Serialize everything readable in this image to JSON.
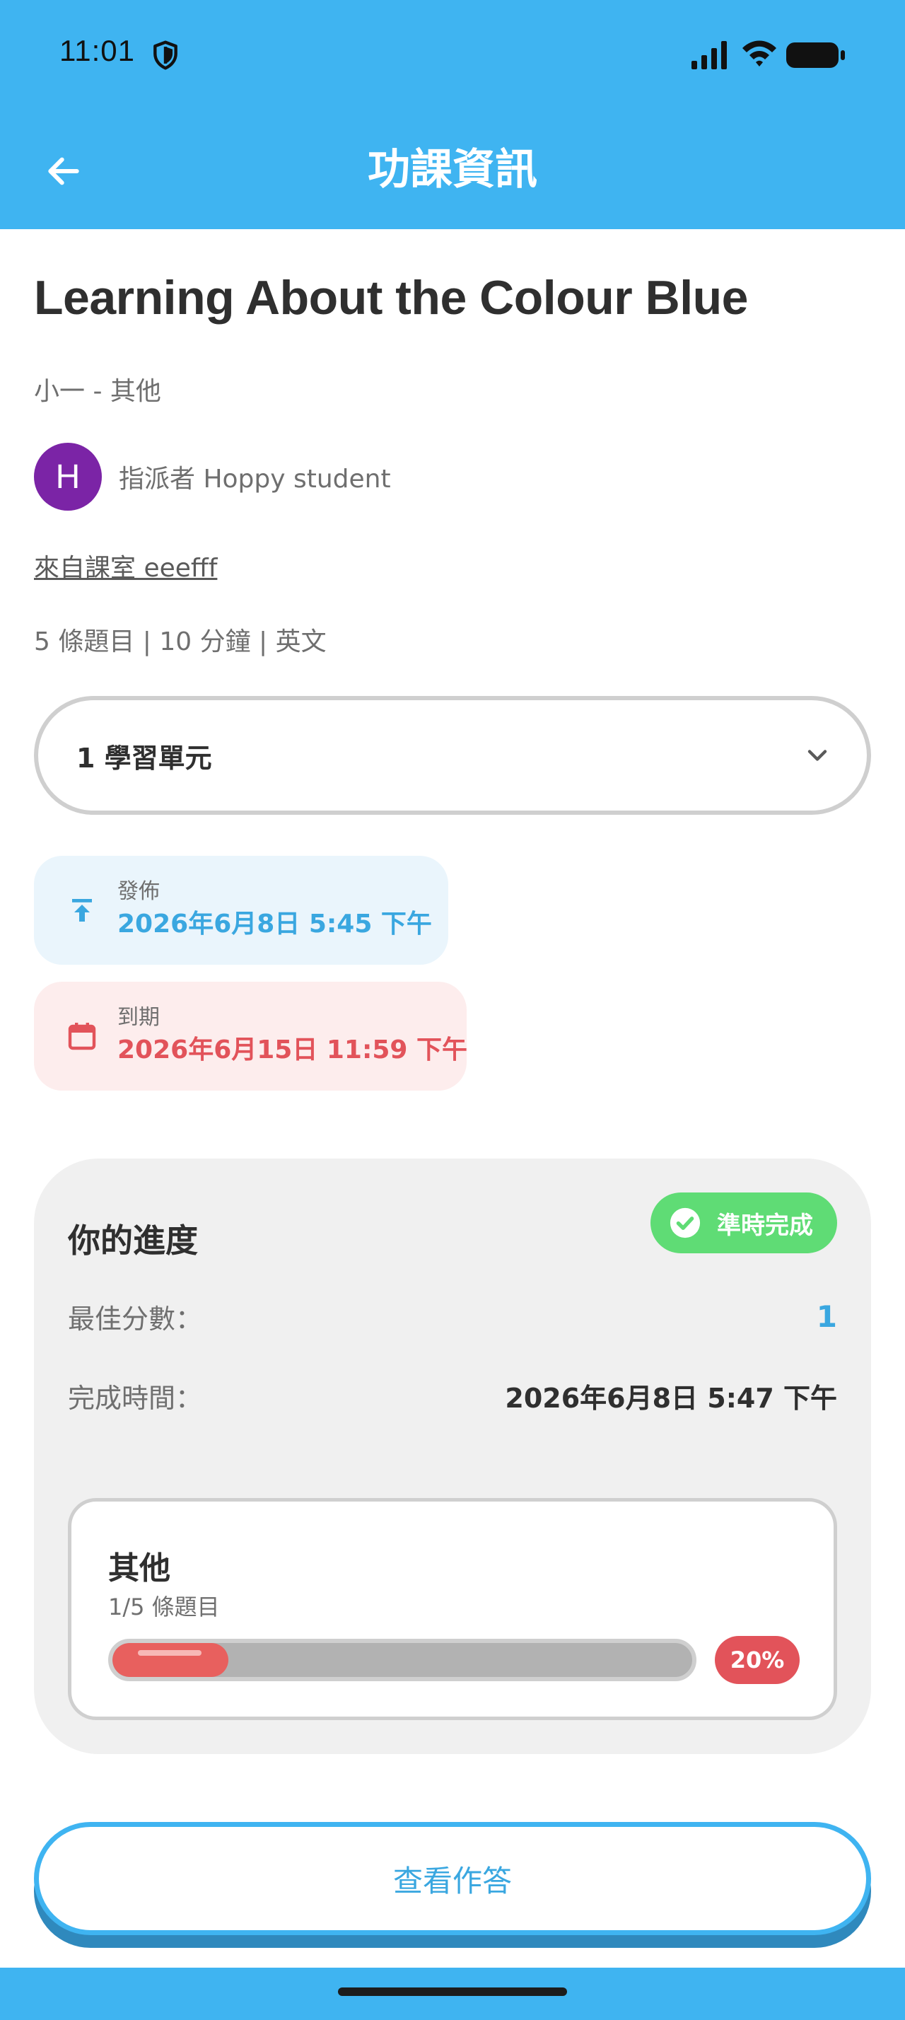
{
  "status_bar": {
    "time": "11:01"
  },
  "header": {
    "title": "功課資訊"
  },
  "assignment": {
    "title": "Learning About the Colour Blue",
    "grade_subject": "小一 - 其他",
    "avatar_initial": "H",
    "assigned_by": "指派者 Hoppy student",
    "classroom": "來自課室 eeefff",
    "meta": "5 條題目 | 10 分鐘 | 英文"
  },
  "units_dropdown": {
    "label": "1 學習單元"
  },
  "dates": {
    "publish_label": "發佈",
    "publish_value": "2026年6月8日 5:45 下午",
    "due_label": "到期",
    "due_value": "2026年6月15日 11:59 下午"
  },
  "progress": {
    "title": "你的進度",
    "status_badge": "準時完成",
    "best_score_label": "最佳分數：",
    "best_score_value": "1",
    "completed_label": "完成時間：",
    "completed_value": "2026年6月8日 5:47 下午",
    "section": {
      "name": "其他",
      "count": "1/5 條題目",
      "percent_label": "20%",
      "percent": 0.2
    }
  },
  "actions": {
    "view_answers": "查看作答"
  },
  "colors": {
    "primary": "#3fb4f1",
    "success": "#5fdc75",
    "danger": "#e2535a",
    "avatar": "#7b24a6"
  },
  "icons": {
    "back": "arrow-left-icon",
    "publish": "upload-icon",
    "due": "calendar-icon",
    "dropdown": "chevron-down-icon",
    "status": "check-circle-icon"
  }
}
